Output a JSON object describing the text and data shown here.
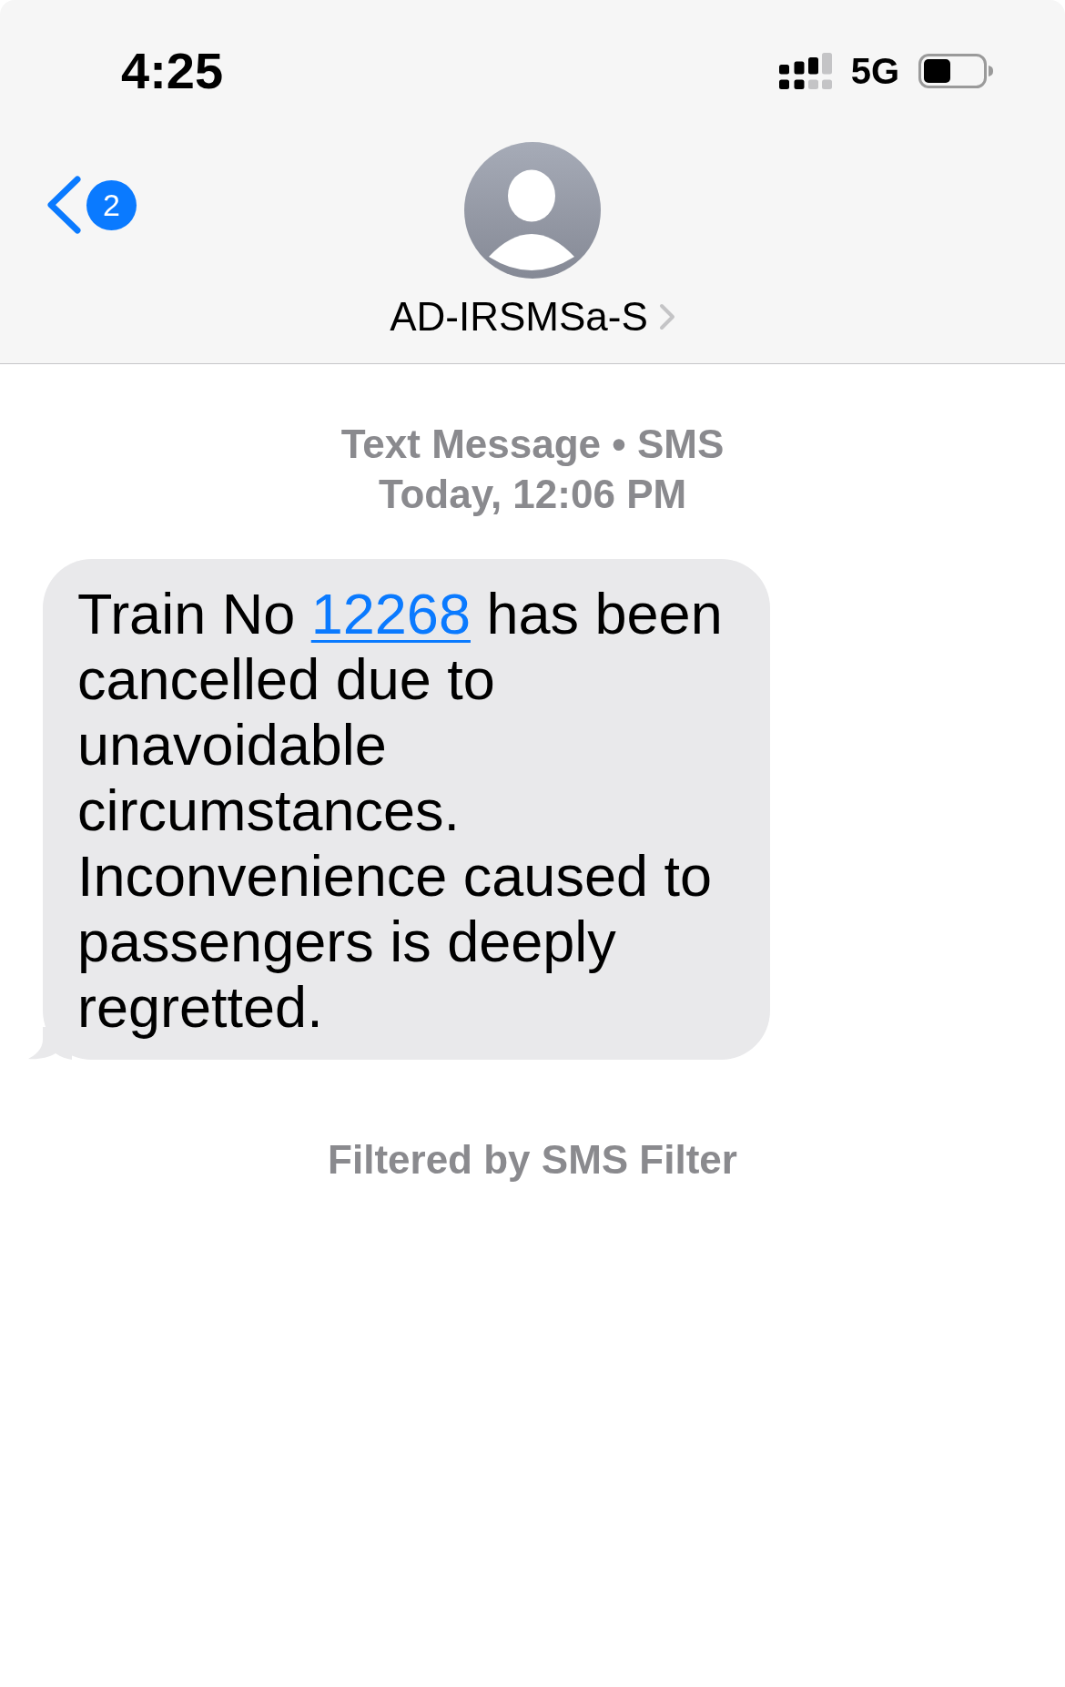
{
  "status_bar": {
    "time": "4:25",
    "network": "5G"
  },
  "header": {
    "back_badge": "2",
    "contact_name": "AD-IRSMSa-S"
  },
  "conversation": {
    "service_label": "Text Message • SMS",
    "timestamp": "Today, 12:06 PM",
    "messages": [
      {
        "kind": "incoming",
        "parts": [
          {
            "kind": "text",
            "text": "Train No "
          },
          {
            "kind": "link",
            "text": "12268"
          },
          {
            "kind": "text",
            "text": " has been cancelled due to unavoidable circumstances. Inconvenience caused to passengers is deeply regretted."
          }
        ]
      }
    ],
    "footer_note": "Filtered by SMS Filter"
  }
}
